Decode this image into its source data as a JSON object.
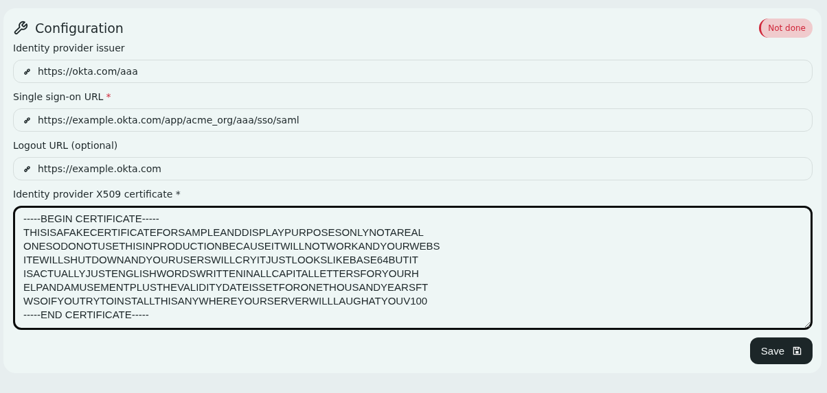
{
  "title": "Configuration",
  "status": {
    "label": "Not done",
    "done": false
  },
  "fields": [
    {
      "label": "Identity provider issuer",
      "value": "https://okta.com/aaa"
    },
    {
      "label": "Single sign-on URL",
      "required_mark": "*",
      "value": "https://example.okta.com/app/acme_org/aaa/sso/saml"
    },
    {
      "label": "Logout URL (optional)",
      "value": "https://example.okta.com"
    }
  ],
  "certificate": {
    "label": "Identity provider X509 certificate *",
    "focused": true,
    "value": "-----BEGIN CERTIFICATE-----\nTHISISAFAKECERTIFICATEFORSAMPLEANDDISPLAYPURPOSESONLYNOTAREAL\nONESODONOTUSETHISINPRODUCTIONBECAUSEITWILLNOTWORKANDYOURWEBS\nITEWILLSHUTDOWNANDYOURUSERSWILLCRYITJUSTLOOKSLIKEBASE64BUTIT\nISACTUALLYJUSTENGLISHWORDSWRITTENINALLCAPITALLETTERSFORYOURH\nELPANDAMUSEMENTPLUSTHEVALIDITYDATEISSETFORONETHOUSANDYEARSFT\nWSOIFYOUTRYTOINSTALLTHISANYWHEREYOURSERVERWILLLAUGHATYOUV100\n-----END CERTIFICATE-----"
  },
  "save_button": {
    "label": "Save"
  }
}
